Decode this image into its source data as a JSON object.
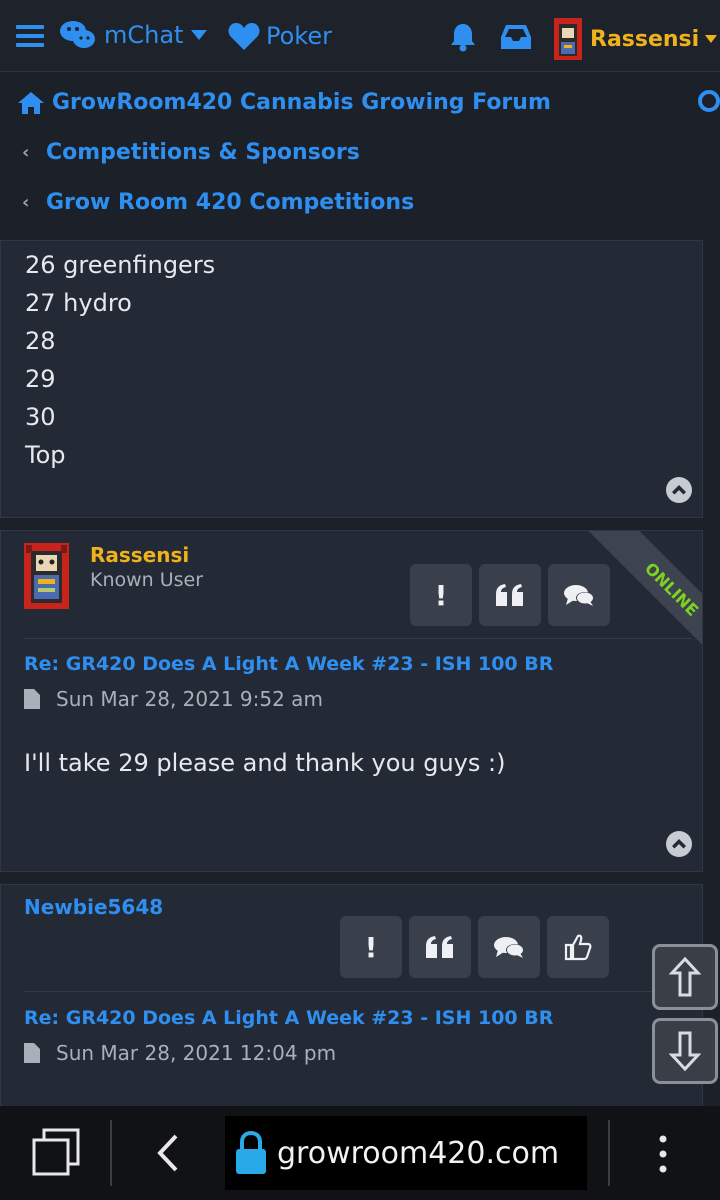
{
  "topbar": {
    "mchat_label": "mChat",
    "poker_label": "Poker",
    "username": "Rassensi"
  },
  "breadcrumbs": [
    {
      "label": "GrowRoom420 Cannabis Growing Forum",
      "icon": "home-icon"
    },
    {
      "label": "Competitions & Sponsors",
      "icon": "chevron-left-icon"
    },
    {
      "label": "Grow Room 420 Competitions",
      "icon": "chevron-left-icon"
    }
  ],
  "list_post": {
    "lines": [
      "26 greenfingers",
      "27 hydro",
      "28",
      "29",
      "30",
      "Top"
    ]
  },
  "post1": {
    "author": "Rassensi",
    "rank": "Known User",
    "status": "ONLINE",
    "title": "Re: GR420 Does A Light A Week #23 - ISH 100 BR",
    "date": "Sun Mar 28, 2021 9:52 am",
    "body": "I'll take 29 please and thank you guys :)"
  },
  "post2": {
    "author": "Newbie5648",
    "title": "Re: GR420 Does A Light A Week #23 - ISH 100 BR",
    "date": "Sun Mar 28, 2021 12:04 pm"
  },
  "browser": {
    "url": "growroom420.com"
  },
  "colors": {
    "accent": "#2f8ff0",
    "username": "#f0b21b",
    "online": "#7ed321",
    "background": "#1c2029"
  }
}
